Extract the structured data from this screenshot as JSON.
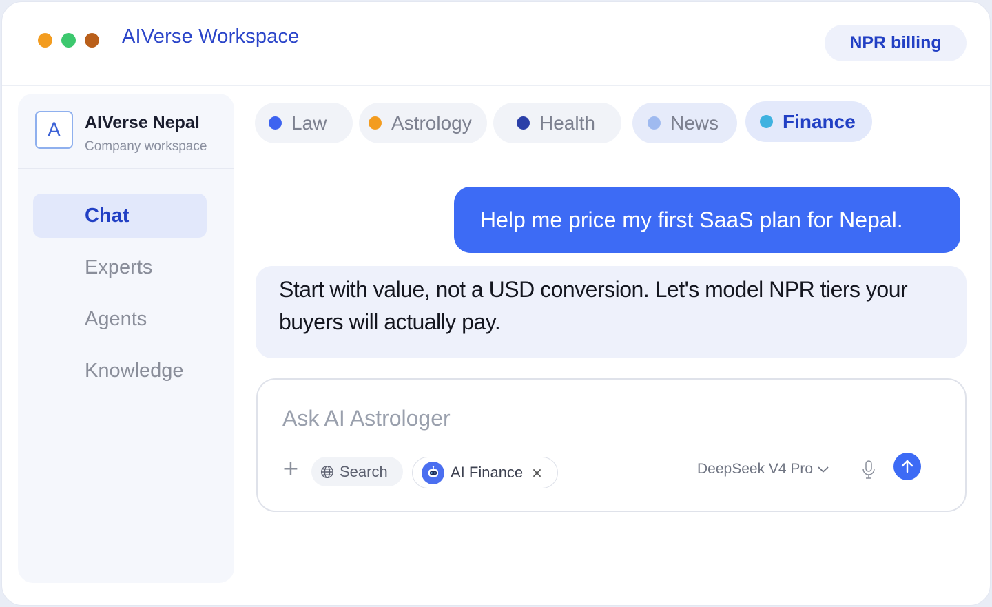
{
  "window": {
    "title": "AIVerse Workspace",
    "billing_label": "NPR billing",
    "traffic_lights": [
      "#f39c1f",
      "#3cc86e",
      "#b95f1a"
    ]
  },
  "sidebar": {
    "org_logo_letter": "A",
    "org_name": "AIVerse Nepal",
    "org_subtitle": "Company workspace",
    "items": [
      {
        "label": "Chat",
        "active": true
      },
      {
        "label": "Experts",
        "active": false
      },
      {
        "label": "Agents",
        "active": false
      },
      {
        "label": "Knowledge",
        "active": false
      }
    ]
  },
  "tabs": [
    {
      "label": "Law",
      "dot_color": "#3d63f0",
      "active": false
    },
    {
      "label": "Astrology",
      "dot_color": "#f39c1f",
      "active": false
    },
    {
      "label": "Health",
      "dot_color": "#2b3fa8",
      "active": false
    },
    {
      "label": "News",
      "dot_color": "#9fbaf0",
      "active": false
    },
    {
      "label": "Finance",
      "dot_color": "#3fb2e0",
      "active": true
    }
  ],
  "messages": {
    "user": "Help me price my first SaaS plan for Nepal.",
    "assistant": "Start with value, not a USD conversion. Let's model NPR tiers your buyers will actually pay."
  },
  "composer": {
    "placeholder": "Ask AI Astrologer",
    "search_label": "Search",
    "expert_chip": "AI Finance",
    "close_glyph": "×",
    "model": "DeepSeek V4 Pro"
  },
  "colors": {
    "accent": "#3d6bf5",
    "brand_text": "#2240c4"
  }
}
